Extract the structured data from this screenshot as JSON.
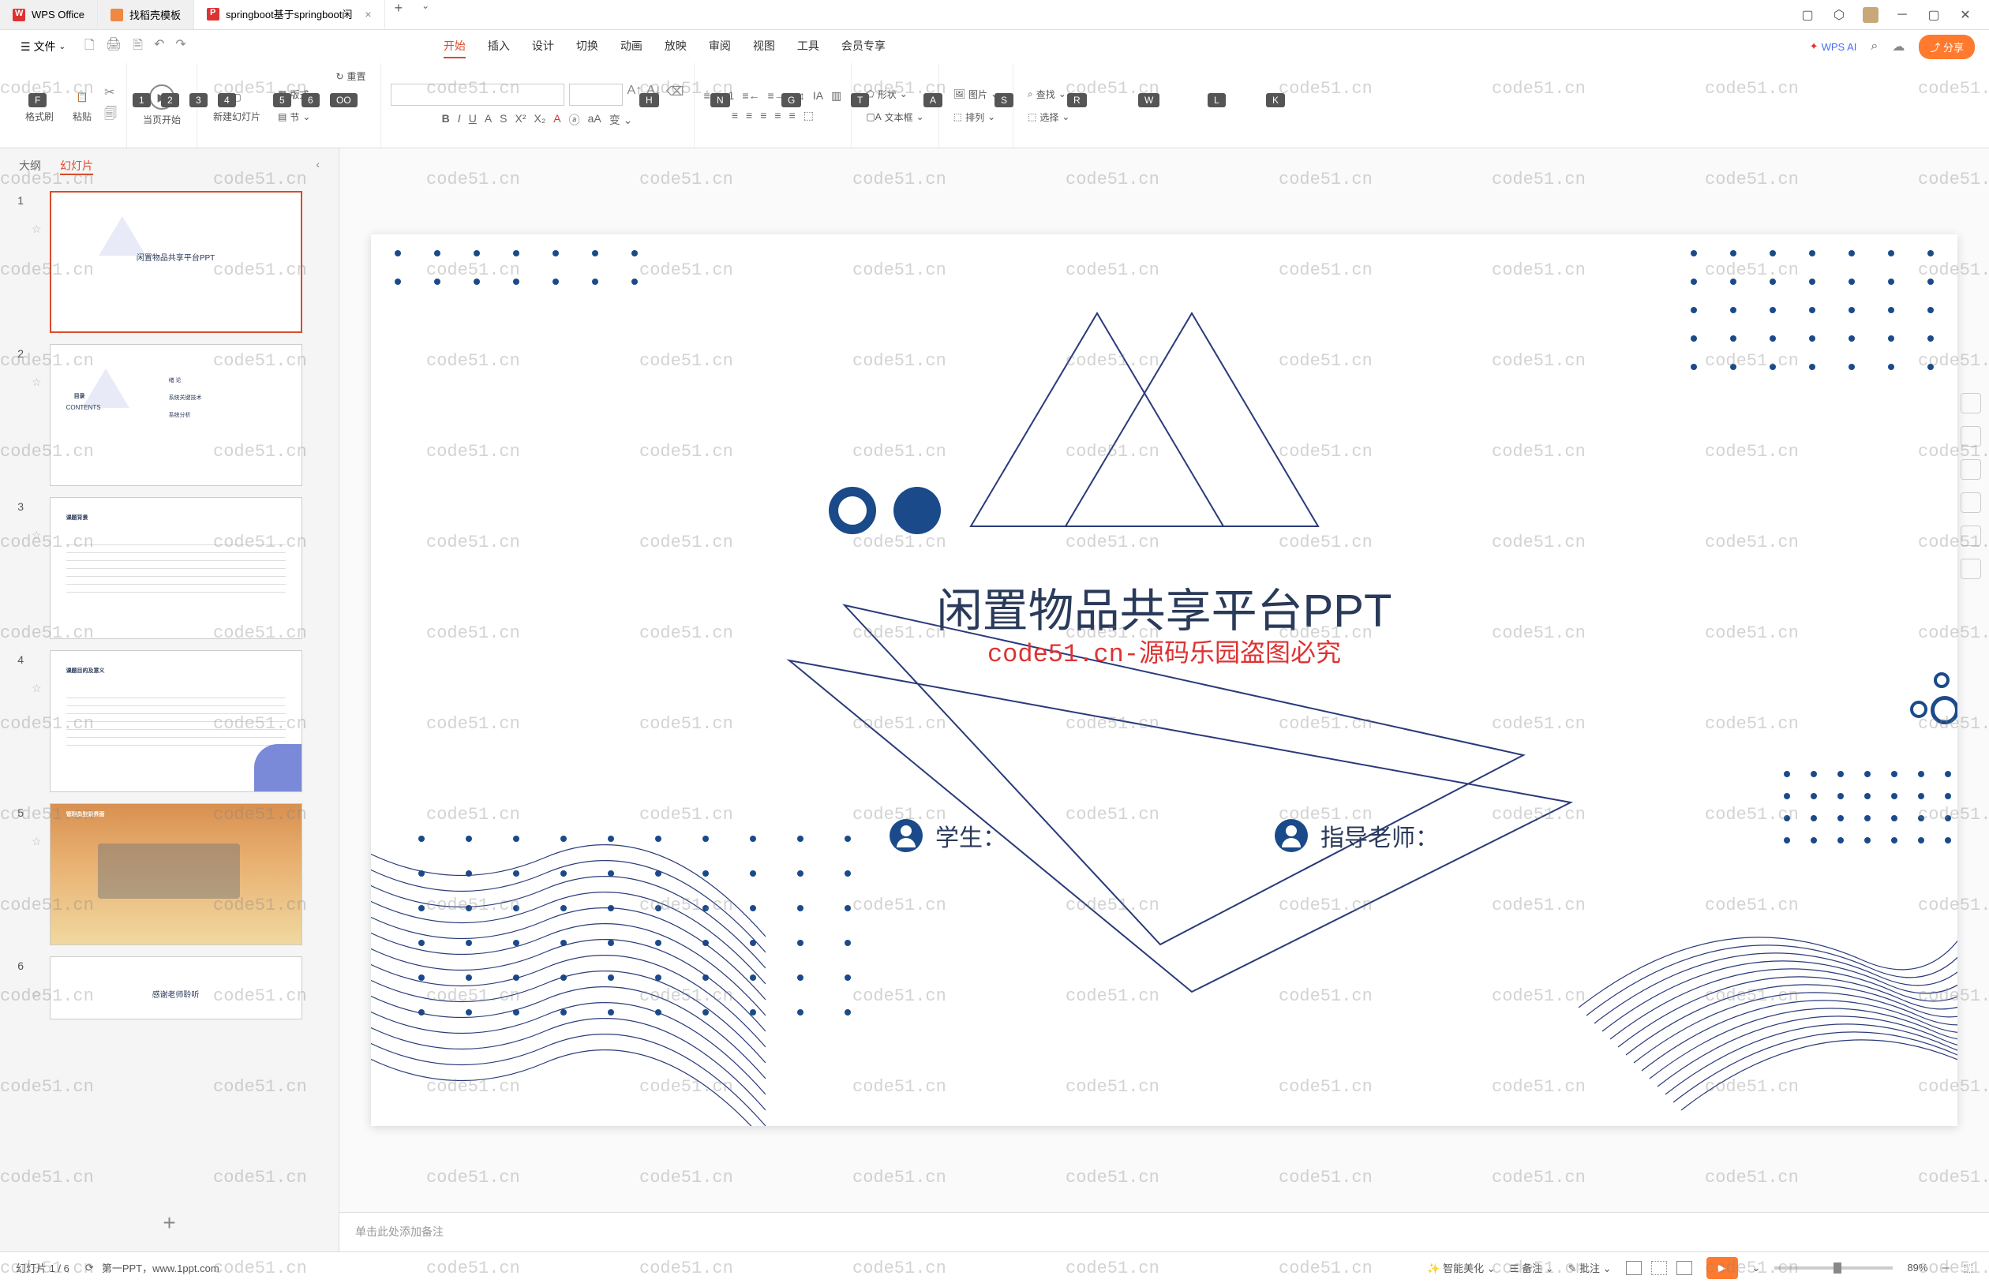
{
  "tabs": {
    "wps": "WPS Office",
    "dk": "找稻壳模板",
    "active": "springboot基于springboot闲"
  },
  "file_menu": "文件",
  "menu": {
    "start": "开始",
    "insert": "插入",
    "design": "设计",
    "transition": "切换",
    "animation": "动画",
    "slideshow": "放映",
    "review": "审阅",
    "view": "视图",
    "tools": "工具",
    "member": "会员专享",
    "wpsai": "WPS AI",
    "share": "分享"
  },
  "hotkeys": {
    "f": "F",
    "one": "1",
    "two": "2",
    "three": "3",
    "four": "4",
    "five": "5",
    "six": "6",
    "h": "H",
    "n": "N",
    "g": "G",
    "t": "T",
    "a": "A",
    "s": "S",
    "r": "R",
    "w": "W",
    "l": "L",
    "k": "K",
    "oo": "OO"
  },
  "ribbon": {
    "format_painter": "格式刷",
    "paste": "粘贴",
    "current_start": "当页开始",
    "new_slide": "新建幻灯片",
    "layout": "版式",
    "section": "节",
    "reset": "重置",
    "shape": "形状",
    "image": "图片",
    "textbox": "文本框",
    "arrange": "排列",
    "find": "查找",
    "select": "选择"
  },
  "sidepanel": {
    "outline": "大纲",
    "slides": "幻灯片"
  },
  "thumbs": {
    "t1": "闲置物品共享平台PPT",
    "t2_dir": "目录",
    "t2_contents": "CONTENTS",
    "t2_a": "绪 论",
    "t2_b": "系统关键技术",
    "t2_c": "系统分析",
    "t3": "课题背景",
    "t4": "课题目的及意义",
    "t5": "管理员登录界面",
    "t6": "感谢老师聆听"
  },
  "slide": {
    "title": "闲置物品共享平台PPT",
    "watermark_center": "code51.cn-源码乐园盗图必究",
    "student": "学生：",
    "teacher": "指导老师："
  },
  "watermark": "code51.cn",
  "notes_placeholder": "单击此处添加备注",
  "status": {
    "slide_count": "幻灯片 1 / 6",
    "source": "第一PPT，www.1ppt.com",
    "beautify": "智能美化",
    "notes": "备注",
    "comments": "批注",
    "zoom": "89%"
  }
}
